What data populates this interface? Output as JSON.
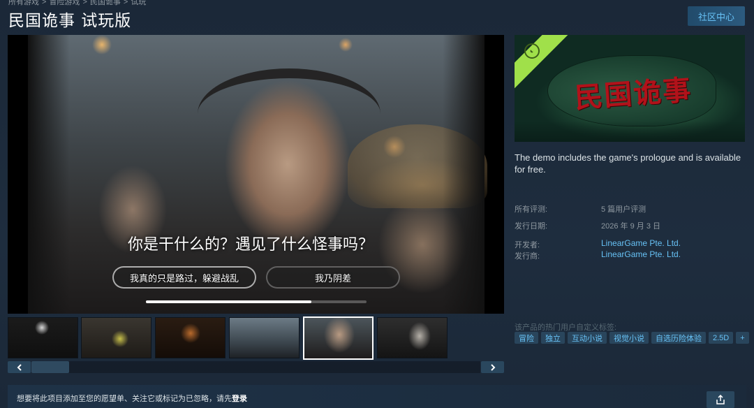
{
  "breadcrumb": [
    "所有游戏",
    "冒险游戏",
    "民国诡事",
    "试玩"
  ],
  "title": "民国诡事 试玩版",
  "community_button": "社区中心",
  "video": {
    "question": "你是干什么的？遇见了什么怪事吗？",
    "choice_1": "我真的只是路过，躲避战乱",
    "choice_2": "我乃阴差",
    "progress": 0.75
  },
  "capsule": {
    "logo_text": "民国诡事"
  },
  "description": "The demo includes the game's prologue and is available for free.",
  "meta": {
    "reviews_label": "所有评测:",
    "reviews_value": "5 篇用户评测",
    "release_label": "发行日期:",
    "release_value": "2026 年 9 月 3 日",
    "developer_label": "开发者:",
    "developer_value": "LinearGame Pte. Ltd.",
    "publisher_label": "发行商:",
    "publisher_value": "LinearGame Pte. Ltd."
  },
  "tags_label": "该产品的热门用户自定义标签:",
  "tags": [
    "冒险",
    "独立",
    "互动小说",
    "视觉小说",
    "自选历险体验",
    "2.5D",
    "+"
  ],
  "bottom": {
    "prefix": "想要将此项目添加至您的愿望单、关注它或标记为已忽略，请先",
    "login": "登录"
  },
  "colors": {
    "accent": "#67c1f5",
    "background": "#1b2838",
    "capsule_corner": "#a0e04a",
    "logo_red": "#b1121a"
  },
  "icons": [
    "theater-mode-icon",
    "fullscreen-icon",
    "chevron-left-icon",
    "chevron-right-icon",
    "share-icon",
    "demo-badge-icon"
  ]
}
